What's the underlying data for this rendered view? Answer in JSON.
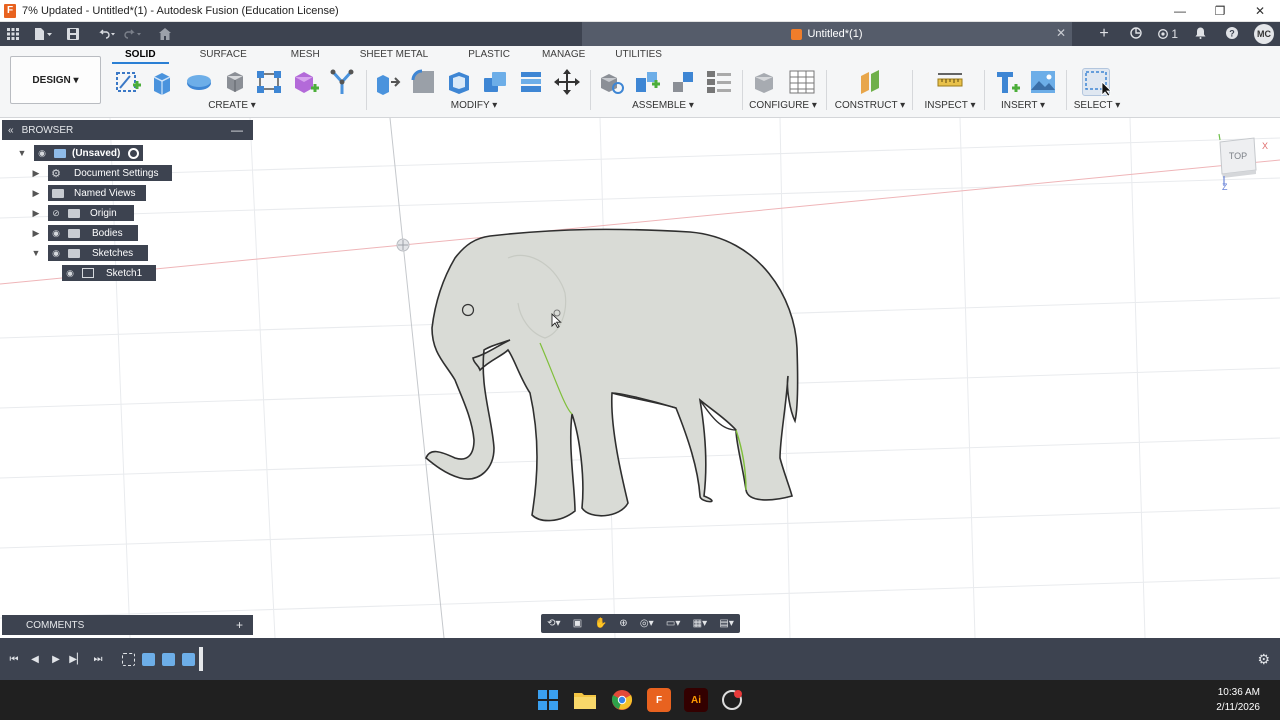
{
  "window": {
    "title": "7% Updated - Untitled*(1) - Autodesk Fusion (Education License)",
    "logo_glyph": "F",
    "minimize": "—",
    "maximize": "❐",
    "close": "✕"
  },
  "tabbar": {
    "doc_tab": "Untitled*(1)",
    "doc_close": "✕",
    "add_tab": "+",
    "job_count": "1",
    "user_initials": "MC"
  },
  "ribbon": {
    "tabs": [
      "SOLID",
      "SURFACE",
      "MESH",
      "SHEET METAL",
      "PLASTIC",
      "MANAGE",
      "UTILITIES"
    ],
    "active_tab": "SOLID",
    "workspace": "DESIGN ▾",
    "groups": {
      "create": "CREATE ▾",
      "modify": "MODIFY ▾",
      "assemble": "ASSEMBLE ▾",
      "configure": "CONFIGURE ▾",
      "construct": "CONSTRUCT ▾",
      "inspect": "INSPECT ▾",
      "insert": "INSERT ▾",
      "select": "SELECT ▾"
    }
  },
  "browser": {
    "title": "BROWSER",
    "items": [
      {
        "label": "(Unsaved)"
      },
      {
        "label": "Document Settings"
      },
      {
        "label": "Named Views"
      },
      {
        "label": "Origin"
      },
      {
        "label": "Bodies"
      },
      {
        "label": "Sketches"
      },
      {
        "label": "Sketch1"
      }
    ]
  },
  "viewcube": {
    "face": "TOP",
    "x_axis": "X",
    "z_axis": "Z"
  },
  "comments": {
    "title": "COMMENTS",
    "add": "+"
  },
  "taskbar": {
    "time": "10:36 AM",
    "date": "2/11/2026",
    "fusion_label": "F",
    "illustrator_label": "Ai"
  },
  "colors": {
    "panel_dark": "#3d4350",
    "ribbon_bg": "#f5f6f7",
    "accent_blue": "#2a7fd4",
    "body_fill": "#d9dbd6",
    "sketch_green": "#7fbf3a"
  }
}
